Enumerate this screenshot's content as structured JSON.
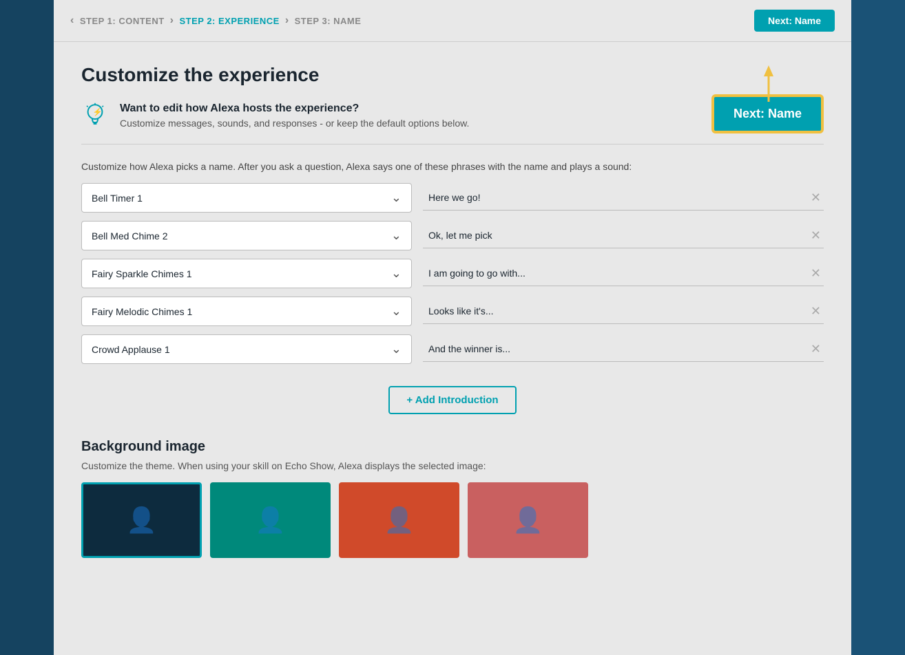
{
  "breadcrumb": {
    "step1": "STEP 1: CONTENT",
    "step2": "STEP 2: EXPERIENCE",
    "step3": "STEP 3: NAME"
  },
  "header": {
    "next_button": "Next: Name"
  },
  "page": {
    "title": "Customize the experience",
    "info_heading": "Want to edit how Alexa hosts the experience?",
    "info_body": "Customize messages, sounds, and responses - or keep the default options below.",
    "customize_desc": "Customize how Alexa picks a name. After you ask a question, Alexa says one of these phrases with the name and plays a sound:",
    "next_callout": "Next: Name"
  },
  "intro_rows": [
    {
      "sound": "Bell Timer 1",
      "phrase": "Here we go!"
    },
    {
      "sound": "Bell Med Chime 2",
      "phrase": "Ok, let me pick"
    },
    {
      "sound": "Fairy Sparkle Chimes 1",
      "phrase": "I am going to go with..."
    },
    {
      "sound": "Fairy Melodic Chimes 1",
      "phrase": "Looks like it's..."
    },
    {
      "sound": "Crowd Applause 1",
      "phrase": "And the winner is..."
    }
  ],
  "add_intro_label": "+ Add Introduction",
  "bg_image": {
    "title": "Background image",
    "desc": "Customize the theme. When using your skill on Echo Show, Alexa displays the selected image:",
    "colors": [
      "#0d2b3e",
      "#00897b",
      "#d04a2a",
      "#c96060"
    ]
  }
}
